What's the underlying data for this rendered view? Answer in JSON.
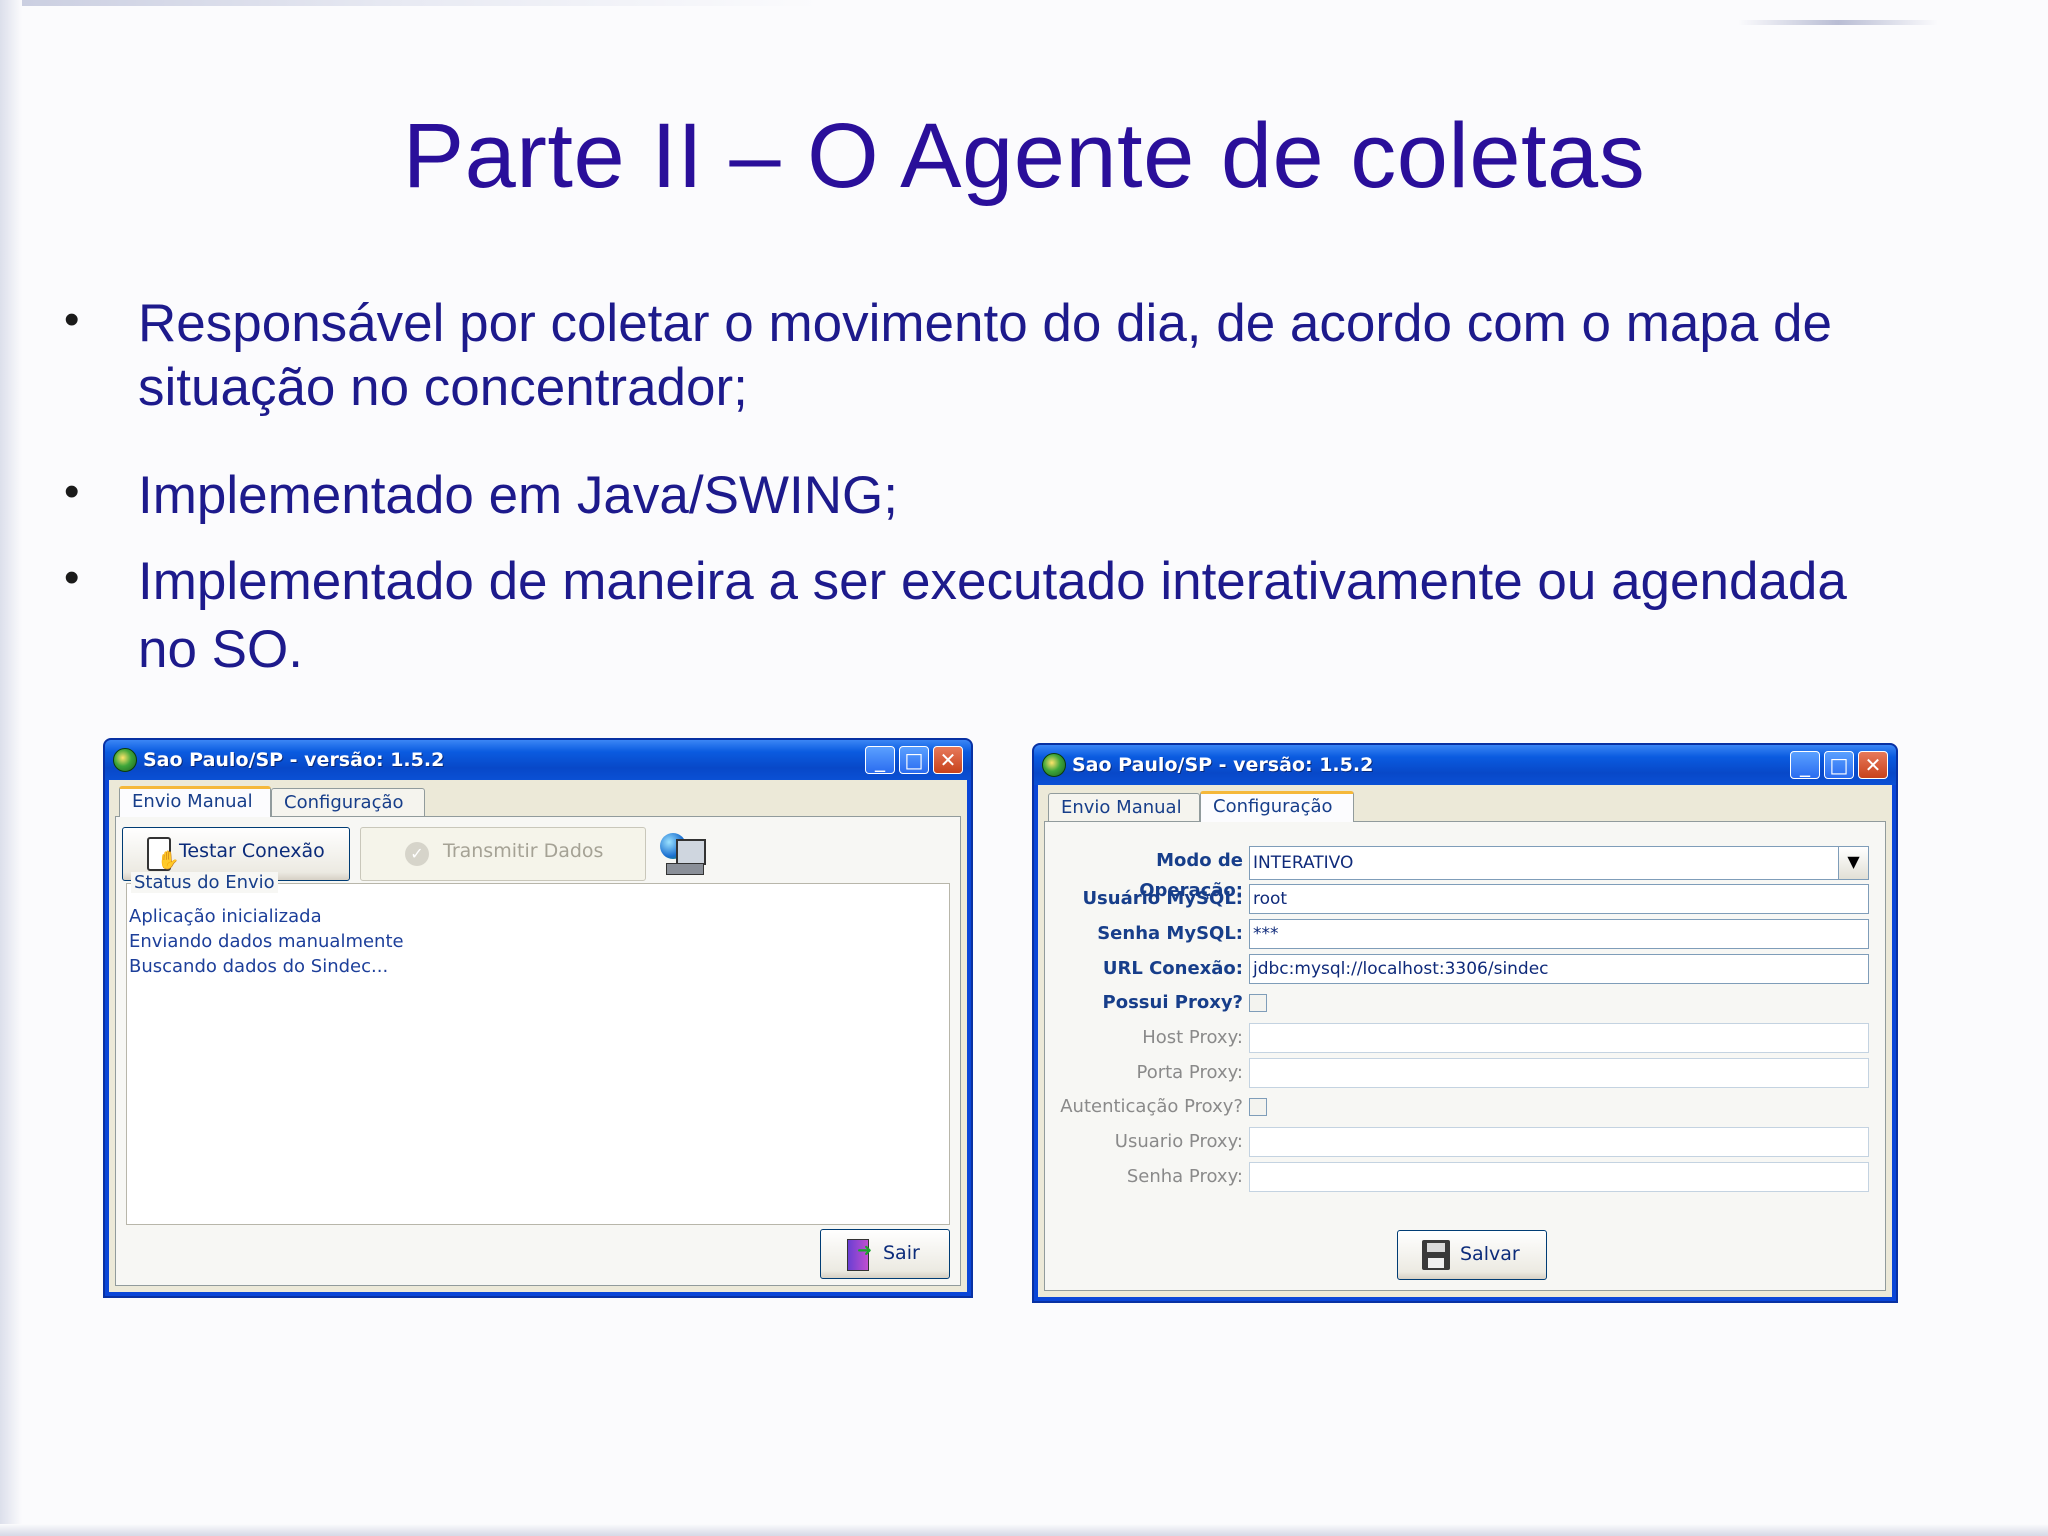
{
  "slide": {
    "title": "Parte II – O Agente de coletas",
    "bullets": [
      {
        "line1": "Responsável por coletar o movimento do dia, de acordo com o mapa de",
        "line2": "situação no concentrador;"
      },
      {
        "line1": "Implementado em Java/SWING;",
        "line2": ""
      },
      {
        "line1": "Implementado de maneira a ser executado interativamente ou agendada",
        "line2": "no SO."
      }
    ]
  },
  "window_left": {
    "title": "Sao Paulo/SP - versão: 1.5.2",
    "tabs": [
      "Envio Manual",
      "Configuração"
    ],
    "active_tab": "Envio Manual",
    "buttons": {
      "test": "Testar Conexão",
      "transmit": "Transmitir Dados",
      "exit": "Sair"
    },
    "status_legend": "Status do Envio",
    "status_lines": [
      "Aplicação inicializada",
      "Enviando dados manualmente",
      "Buscando dados do Sindec..."
    ]
  },
  "window_right": {
    "title": "Sao Paulo/SP - versão: 1.5.2",
    "tabs": [
      "Envio Manual",
      "Configuração"
    ],
    "active_tab": "Configuração",
    "fields": {
      "mode_label": "Modo de Operação:",
      "mode_value": "INTERATIVO",
      "user_label": "Usuário MySQL:",
      "user_value": "root",
      "pass_label": "Senha MySQL:",
      "pass_value": "***",
      "url_label": "URL Conexão:",
      "url_value": "jdbc:mysql://localhost:3306/sindec",
      "proxy_label": "Possui Proxy?",
      "host_label": "Host Proxy:",
      "port_label": "Porta Proxy:",
      "auth_label": "Autenticação Proxy?",
      "proxy_user_label": "Usuario Proxy:",
      "proxy_pass_label": "Senha Proxy:"
    },
    "save_button": "Salvar"
  },
  "colors": {
    "title": "#2a0f9a",
    "bullet_text": "#1d1a8c",
    "xp_blue": "#0a46d8",
    "xp_face": "#ece9d8"
  }
}
